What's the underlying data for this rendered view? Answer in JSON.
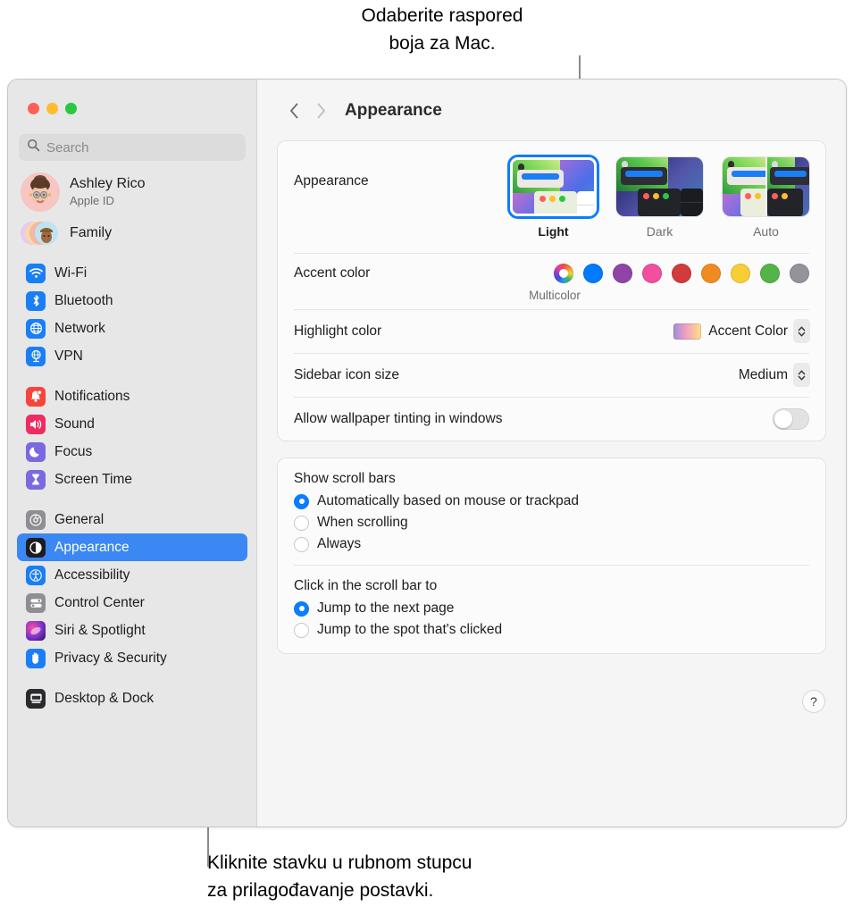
{
  "callouts": {
    "top": "Odaberite raspored\nboja za Mac.",
    "bottom": "Kliknite stavku u rubnom stupcu\nza prilagođavanje postavki."
  },
  "window": {
    "traffic_lights": [
      "close",
      "minimize",
      "zoom"
    ]
  },
  "sidebar": {
    "search": {
      "placeholder": "Search",
      "value": "",
      "icon": "search-icon"
    },
    "account": {
      "name": "Ashley Rico",
      "subtitle": "Apple ID",
      "avatar": "memoji-avatar"
    },
    "family": {
      "label": "Family",
      "icon": "family-icon"
    },
    "groups": [
      {
        "items": [
          {
            "label": "Wi-Fi",
            "icon": "wifi-icon",
            "color": "#1a7ef5"
          },
          {
            "label": "Bluetooth",
            "icon": "bluetooth-icon",
            "color": "#1a7ef5"
          },
          {
            "label": "Network",
            "icon": "globe-icon",
            "color": "#1a7ef5"
          },
          {
            "label": "VPN",
            "icon": "vpn-icon",
            "color": "#1a7ef5"
          }
        ]
      },
      {
        "items": [
          {
            "label": "Notifications",
            "icon": "bell-icon",
            "color": "#f6453c"
          },
          {
            "label": "Sound",
            "icon": "speaker-icon",
            "color": "#ef2c62"
          },
          {
            "label": "Focus",
            "icon": "moon-icon",
            "color": "#7a6ae0"
          },
          {
            "label": "Screen Time",
            "icon": "hourglass-icon",
            "color": "#7a6ae0"
          }
        ]
      },
      {
        "items": [
          {
            "label": "General",
            "icon": "gear-icon",
            "color": "#8e8e93"
          },
          {
            "label": "Appearance",
            "icon": "appearance-icon",
            "color": "#1d1d1f",
            "selected": true
          },
          {
            "label": "Accessibility",
            "icon": "accessibility-icon",
            "color": "#1a7ef5"
          },
          {
            "label": "Control Center",
            "icon": "control-center-icon",
            "color": "#8e8e93"
          },
          {
            "label": "Siri & Spotlight",
            "icon": "siri-icon",
            "color": "#2b2b3a"
          },
          {
            "label": "Privacy & Security",
            "icon": "hand-icon",
            "color": "#1a7ef5"
          }
        ]
      },
      {
        "items": [
          {
            "label": "Desktop & Dock",
            "icon": "desktop-dock-icon",
            "color": "#2b2b2e"
          }
        ]
      }
    ]
  },
  "detail": {
    "title": "Appearance",
    "back_icon": "chevron-left-icon",
    "forward_icon": "chevron-right-icon",
    "appearance": {
      "label": "Appearance",
      "options": [
        {
          "name": "Light",
          "selected": true
        },
        {
          "name": "Dark",
          "selected": false
        },
        {
          "name": "Auto",
          "selected": false
        }
      ]
    },
    "accent_color": {
      "label": "Accent color",
      "caption": "Multicolor",
      "swatches": [
        {
          "name": "Multicolor",
          "color": "multicolor",
          "selected": true
        },
        {
          "name": "Blue",
          "color": "#007aff"
        },
        {
          "name": "Purple",
          "color": "#9044a8"
        },
        {
          "name": "Pink",
          "color": "#f0509e"
        },
        {
          "name": "Red",
          "color": "#d23b3b"
        },
        {
          "name": "Orange",
          "color": "#f08b21"
        },
        {
          "name": "Yellow",
          "color": "#f8ce36"
        },
        {
          "name": "Green",
          "color": "#52b449"
        },
        {
          "name": "Graphite",
          "color": "#939399"
        }
      ]
    },
    "highlight_color": {
      "label": "Highlight color",
      "value": "Accent Color"
    },
    "sidebar_icon_size": {
      "label": "Sidebar icon size",
      "value": "Medium"
    },
    "wallpaper_tinting": {
      "label": "Allow wallpaper tinting in windows",
      "on": false
    },
    "show_scroll_bars": {
      "label": "Show scroll bars",
      "options": [
        {
          "label": "Automatically based on mouse or trackpad",
          "selected": true
        },
        {
          "label": "When scrolling",
          "selected": false
        },
        {
          "label": "Always",
          "selected": false
        }
      ]
    },
    "click_scroll_bar": {
      "label": "Click in the scroll bar to",
      "options": [
        {
          "label": "Jump to the next page",
          "selected": true
        },
        {
          "label": "Jump to the spot that's clicked",
          "selected": false
        }
      ]
    },
    "help": {
      "label": "?"
    }
  }
}
